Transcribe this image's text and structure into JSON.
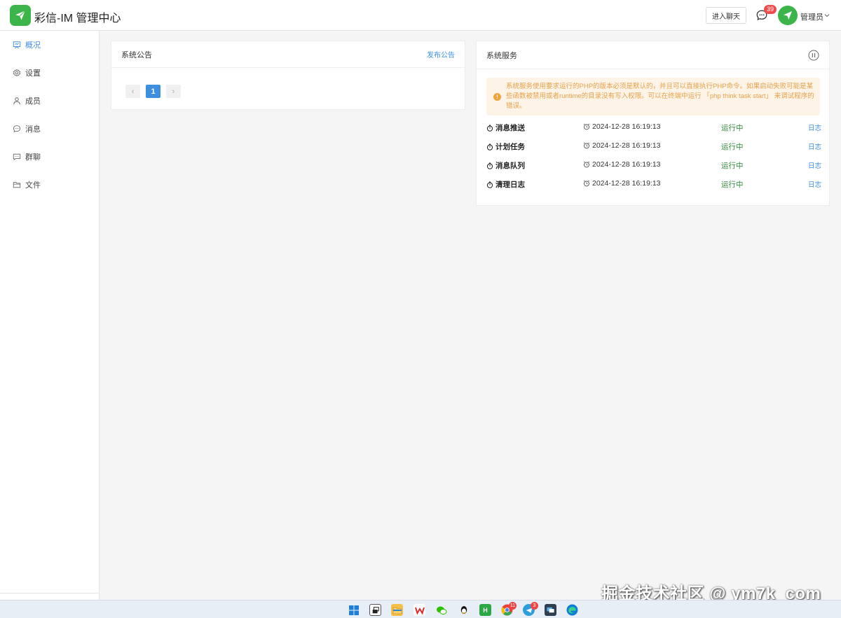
{
  "header": {
    "brand": "彩信-IM 管理中心",
    "enter_chat_label": "进入聊天",
    "message_badge": "39",
    "user_name": "管理员"
  },
  "sidebar": {
    "items": [
      {
        "label": "概况",
        "icon": "dashboard-icon",
        "active": true
      },
      {
        "label": "设置",
        "icon": "gear-icon",
        "active": false
      },
      {
        "label": "成员",
        "icon": "user-icon",
        "active": false
      },
      {
        "label": "消息",
        "icon": "chat-icon",
        "active": false
      },
      {
        "label": "群聊",
        "icon": "group-chat-icon",
        "active": false
      },
      {
        "label": "文件",
        "icon": "folder-icon",
        "active": false
      }
    ]
  },
  "announcements": {
    "title": "系统公告",
    "publish_label": "发布公告",
    "pager": {
      "prev": "‹",
      "current": "1",
      "next": "›"
    }
  },
  "services": {
    "title": "系统服务",
    "alert": "系统服务使用要求运行的PHP的版本必须是默认的，并且可以直接执行PHP命令。如果启动失败可能是某些函数被禁用或者runtime的目录没有写入权限。可以在终端中运行 「php think task start」 来调试程序的错误。",
    "rows": [
      {
        "name": "消息推送",
        "time": "2024-12-28 16:19:13",
        "status": "运行中",
        "log": "日志"
      },
      {
        "name": "计划任务",
        "time": "2024-12-28 16:19:13",
        "status": "运行中",
        "log": "日志"
      },
      {
        "name": "消息队列",
        "time": "2024-12-28 16:19:13",
        "status": "运行中",
        "log": "日志"
      },
      {
        "name": "清理日志",
        "time": "2024-12-28 16:19:13",
        "status": "运行中",
        "log": "日志"
      }
    ]
  },
  "watermark": "掘金技术社区 @ ym7k_com",
  "taskbar": {
    "chrome_badge": "11",
    "telegram_badge": "3"
  },
  "colors": {
    "brand_green": "#3bb54a",
    "accent_blue": "#3d8fe0",
    "running_green": "#2f8a3a",
    "alert_text": "#e6a24a",
    "alert_bg": "#fdf3e6"
  }
}
